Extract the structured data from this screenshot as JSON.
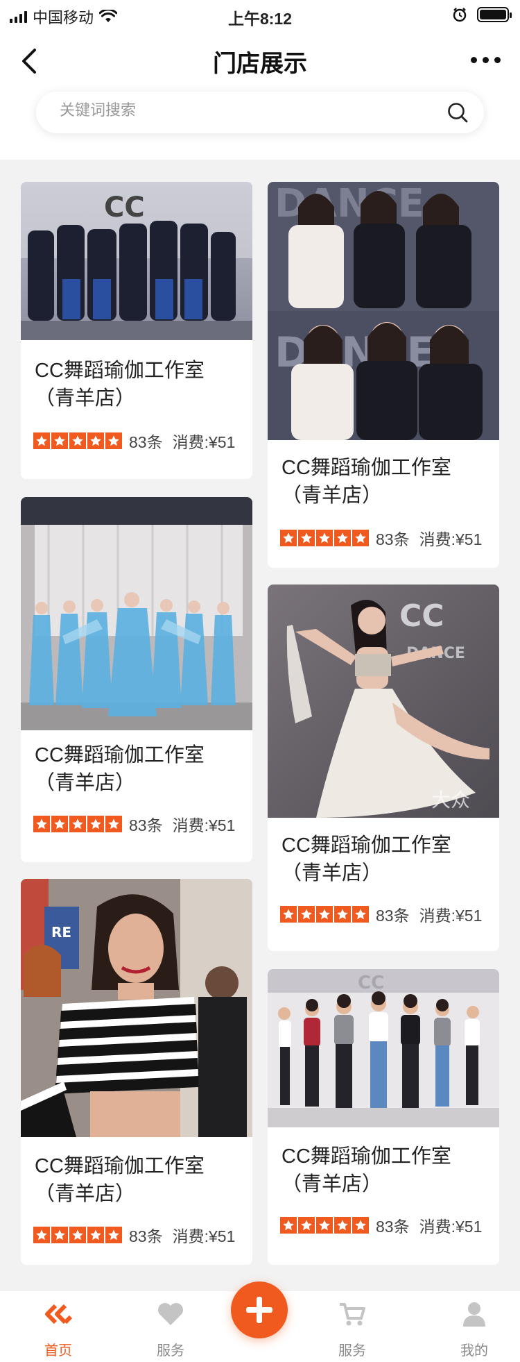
{
  "status_bar": {
    "carrier": "中国移动",
    "time": "上午8:12"
  },
  "nav": {
    "title": "门店展示"
  },
  "search": {
    "placeholder": "关键词搜索"
  },
  "cards": [
    {
      "title": "CC舞蹈瑜伽工作室（青羊店）",
      "reviews": "83条",
      "cost": "消费:¥51",
      "rating": 5
    },
    {
      "title": "CC舞蹈瑜伽工作室（青羊店）",
      "reviews": "83条",
      "cost": "消费:¥51",
      "rating": 5
    },
    {
      "title": "CC舞蹈瑜伽工作室（青羊店）",
      "reviews": "83条",
      "cost": "消费:¥51",
      "rating": 5
    },
    {
      "title": "CC舞蹈瑜伽工作室（青羊店）",
      "reviews": "83条",
      "cost": "消费:¥51",
      "rating": 5
    },
    {
      "title": "CC舞蹈瑜伽工作室（青羊店）",
      "reviews": "83条",
      "cost": "消费:¥51",
      "rating": 5
    },
    {
      "title": "CC舞蹈瑜伽工作室（青羊店）",
      "reviews": "83条",
      "cost": "消费:¥51",
      "rating": 5
    }
  ],
  "tabs": [
    {
      "label": "首页",
      "icon": "home-logo-icon"
    },
    {
      "label": "服务",
      "icon": "heart-icon"
    },
    {
      "label": "服务",
      "icon": "cart-icon"
    },
    {
      "label": "我的",
      "icon": "user-icon"
    }
  ],
  "colors": {
    "accent": "#f05a1e",
    "background": "#f2f2f2"
  }
}
